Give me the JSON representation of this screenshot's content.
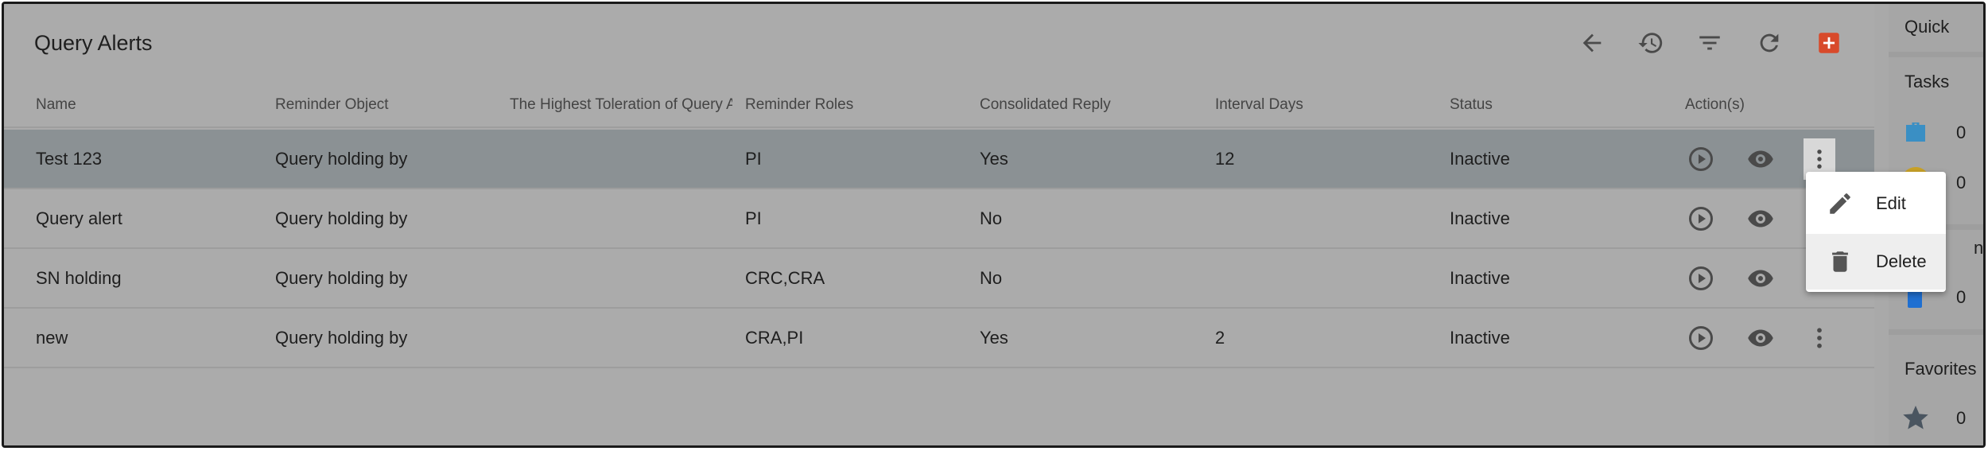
{
  "header": {
    "title": "Query Alerts",
    "toolbar": {
      "back_icon": "arrow-left-icon",
      "history_icon": "history-icon",
      "filter_icon": "filter-icon",
      "refresh_icon": "refresh-icon",
      "add_icon": "add-icon"
    }
  },
  "table": {
    "columns": [
      "Name",
      "Reminder Object",
      "The Highest Toleration of Query A",
      "Reminder Roles",
      "Consolidated Reply",
      "Interval Days",
      "Status",
      "Action(s)"
    ],
    "rows": [
      {
        "name": "Test 123",
        "reminder_object": "Query holding by",
        "toleration": "",
        "roles": "PI",
        "consolidated": "Yes",
        "interval": "12",
        "status": "Inactive"
      },
      {
        "name": "Query alert",
        "reminder_object": "Query holding by",
        "toleration": "",
        "roles": "PI",
        "consolidated": "No",
        "interval": "",
        "status": "Inactive"
      },
      {
        "name": "SN holding",
        "reminder_object": "Query holding by",
        "toleration": "",
        "roles": "CRC,CRA",
        "consolidated": "No",
        "interval": "",
        "status": "Inactive"
      },
      {
        "name": "new",
        "reminder_object": "Query holding by",
        "toleration": "",
        "roles": "CRA,PI",
        "consolidated": "Yes",
        "interval": "2",
        "status": "Inactive"
      }
    ]
  },
  "menu": {
    "edit_label": "Edit",
    "delete_label": "Delete"
  },
  "quick": {
    "title": "Quick",
    "tasks_title": "Tasks",
    "tasks_count": "0",
    "second_count": "0",
    "third_count": "0",
    "partial_label": "n",
    "favorites_title": "Favorites",
    "favorites_count": "0"
  },
  "colors": {
    "add_button": "#d84a2b",
    "briefcase": "#3a8fc4",
    "coin": "#c9a227",
    "blue_item": "#1f6fd1",
    "star": "#4a5560"
  }
}
